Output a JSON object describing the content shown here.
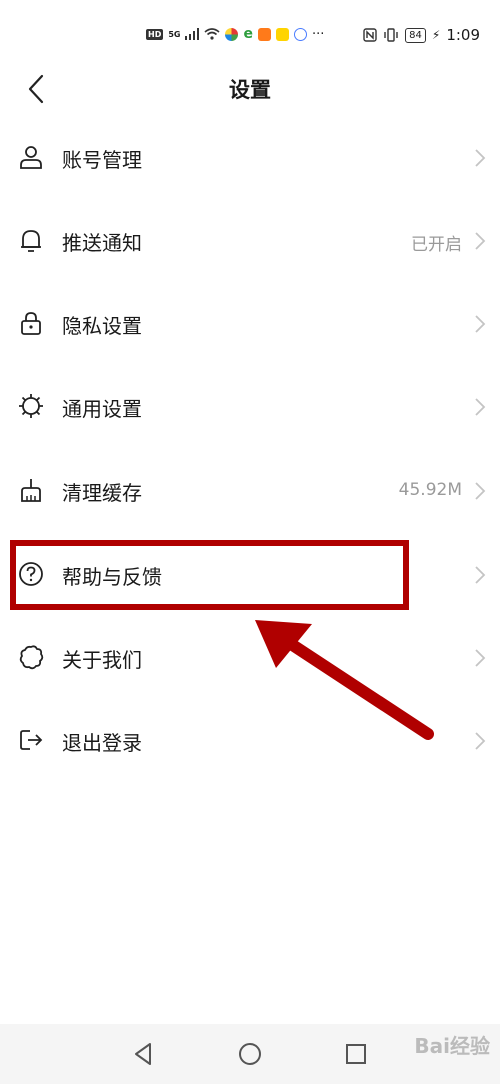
{
  "status_bar": {
    "left_badges": [
      "HD",
      "5G"
    ],
    "time": "1:09",
    "battery": "84",
    "more": "···"
  },
  "header": {
    "title": "设置"
  },
  "menu": [
    {
      "label": "账号管理",
      "icon": "person-icon",
      "value": ""
    },
    {
      "label": "推送通知",
      "icon": "bell-icon",
      "value": "已开启"
    },
    {
      "label": "隐私设置",
      "icon": "lock-icon",
      "value": ""
    },
    {
      "label": "通用设置",
      "icon": "gear-icon",
      "value": ""
    },
    {
      "label": "清理缓存",
      "icon": "broom-icon",
      "value": "45.92M"
    },
    {
      "label": "帮助与反馈",
      "icon": "help-icon",
      "value": ""
    },
    {
      "label": "关于我们",
      "icon": "flower-icon",
      "value": ""
    },
    {
      "label": "退出登录",
      "icon": "logout-icon",
      "value": ""
    }
  ],
  "watermark": "Bai经验",
  "colors": {
    "highlight": "#b00000",
    "text": "#1a1a1a",
    "muted": "#9a9a9a",
    "nav_bg": "#f5f5f5"
  }
}
